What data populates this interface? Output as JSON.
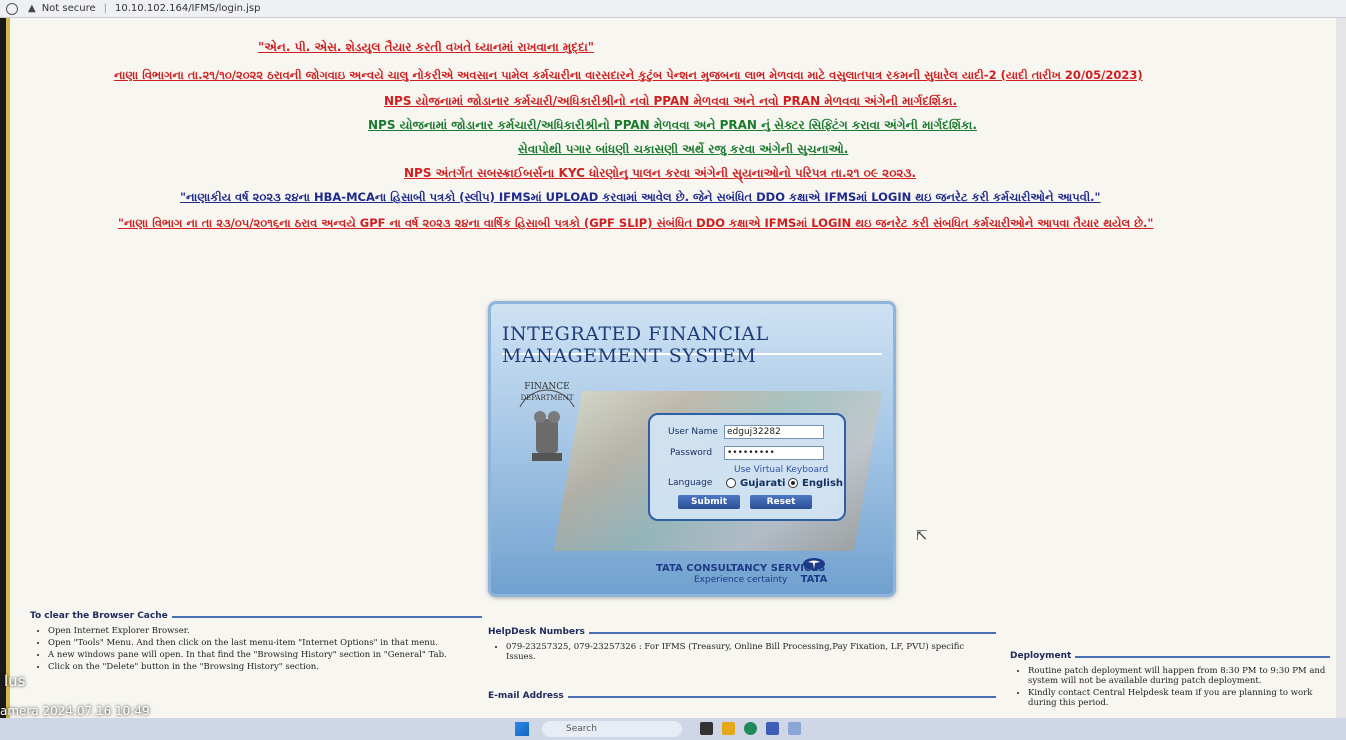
{
  "browser": {
    "security_label": "Not secure",
    "url": "10.10.102.164/IFMS/login.jsp"
  },
  "notices": [
    "\"એન. પી. એસ. શેડયુલ તૈયાર કરતી વખતે ધ્યાનમાં રાખવાના મુદ્દા\"",
    "નાણા વિભાગના તા.૨૧/૧૦/૨૦૨૨ ઠરાવની જોગવાઇ અન્વયે ચાલુ નોકરીએ અવસાન પામેલ કર્મચારીના વારસદારને કુટુંબ પેન્શન મુજબના લાભ મેળવવા માટે વસુલાતપાત્ર રકમની સુધારેલ યાદી-2 (યાદી તારીખ 20/05/2023)",
    "NPS યોજનામાં જોડાનાર કર્મચારી/અધિકારીશ્રીનો નવો PPAN મેળવવા અને નવો PRAN મેળવવા અંગેની માર્ગદર્શિકા.",
    "NPS યોજનામાં જોડાનાર કર્મચારી/અધિકારીશ્રીનો PPAN મેળવવા અને PRAN નું સેક્ટર સિફ્ટિંગ કરાવા અંગેની માર્ગદર્શિકા.",
    "સેવાપોથી પગાર બાંધણી ચકાસણી અર્થે રજુ કરવા અંગેની સુચનાઓ.",
    "NPS અંતર્ગત સબસ્ક્રાઈબર્સના KYC ધોરણોનુ પાલન કરવા અંગેની સુ્યનાઓનો પરિપત્ર તા.૨૧ ૦૯ ૨૦૨૩.",
    "\"નાણાકીય વર્ષ ૨૦૨૩ ૨૪ના HBA-MCAના હિસાબી પત્રકો (સ્લીપ) IFMSમાં UPLOAD કરવામાં આવેલ છે. જેને સબંધિત DDO કક્ષાએ IFMSમાં LOGIN થઇ જનરેટ કરી કર્મચારીઓને આપવી.\"",
    "\"નાણા વિભાગ ના તા ૨૩/૦૫/૨૦૧૬ના ઠરાવ અન્વયે GPF ના વર્ષ ૨૦૨૩ ૨૪ના વાર્ષિક હિસાબી પત્રકો (GPF SLIP) સંબંધિત DDO કક્ષાએ IFMSમાં LOGIN થઇ જનરેટ કરી સંબધિત કર્મચારીઓને આપવા તૈયાર થયેલ છે.\""
  ],
  "ifms": {
    "title": "INTEGRATED FINANCIAL MANAGEMENT SYSTEM",
    "emblem_text": "FINANCE DEPARTMENT",
    "username_label": "User Name",
    "username_value": "edguj32282",
    "password_label": "Password",
    "password_value": "•••••••••",
    "virtual_keyboard": "Use Virtual Keyboard",
    "language_label": "Language",
    "lang_gujarati": "Gujarati",
    "lang_english": "English",
    "submit": "Submit",
    "reset": "Reset",
    "tcs_name": "TATA CONSULTANCY SERVICES",
    "tcs_tagline": "Experience certainty",
    "tata": "TATA"
  },
  "cache_box": {
    "title": "To clear the Browser Cache",
    "items": [
      "Open Internet Explorer Browser.",
      "Open \"Tools\" Menu. And then click on the last menu-item \"Internet Options\" in that menu.",
      "A new windows pane will open. In that find the \"Browsing History\" section in \"General\" Tab.",
      "Click on the \"Delete\" button in the \"Browsing History\" section."
    ]
  },
  "helpdesk_box": {
    "title": "HelpDesk Numbers",
    "items": [
      "079-23257325, 079-23257326 : For IFMS (Treasury, Online Bill Processing,Pay Fixation, LF, PVU) specific Issues."
    ],
    "email_title": "E-mail Address"
  },
  "deploy_box": {
    "title": "Deployment",
    "items": [
      "Routine patch deployment will happen from 8:30 PM to 9:30 PM and system will not be available during patch deployment.",
      "Kindly contact Central Helpdesk team if you are planning to work during this period."
    ]
  },
  "taskbar": {
    "search": "Search"
  },
  "camera_stamp": {
    "brand": "lus",
    "line": "amera  2024.07.16 10:49"
  }
}
